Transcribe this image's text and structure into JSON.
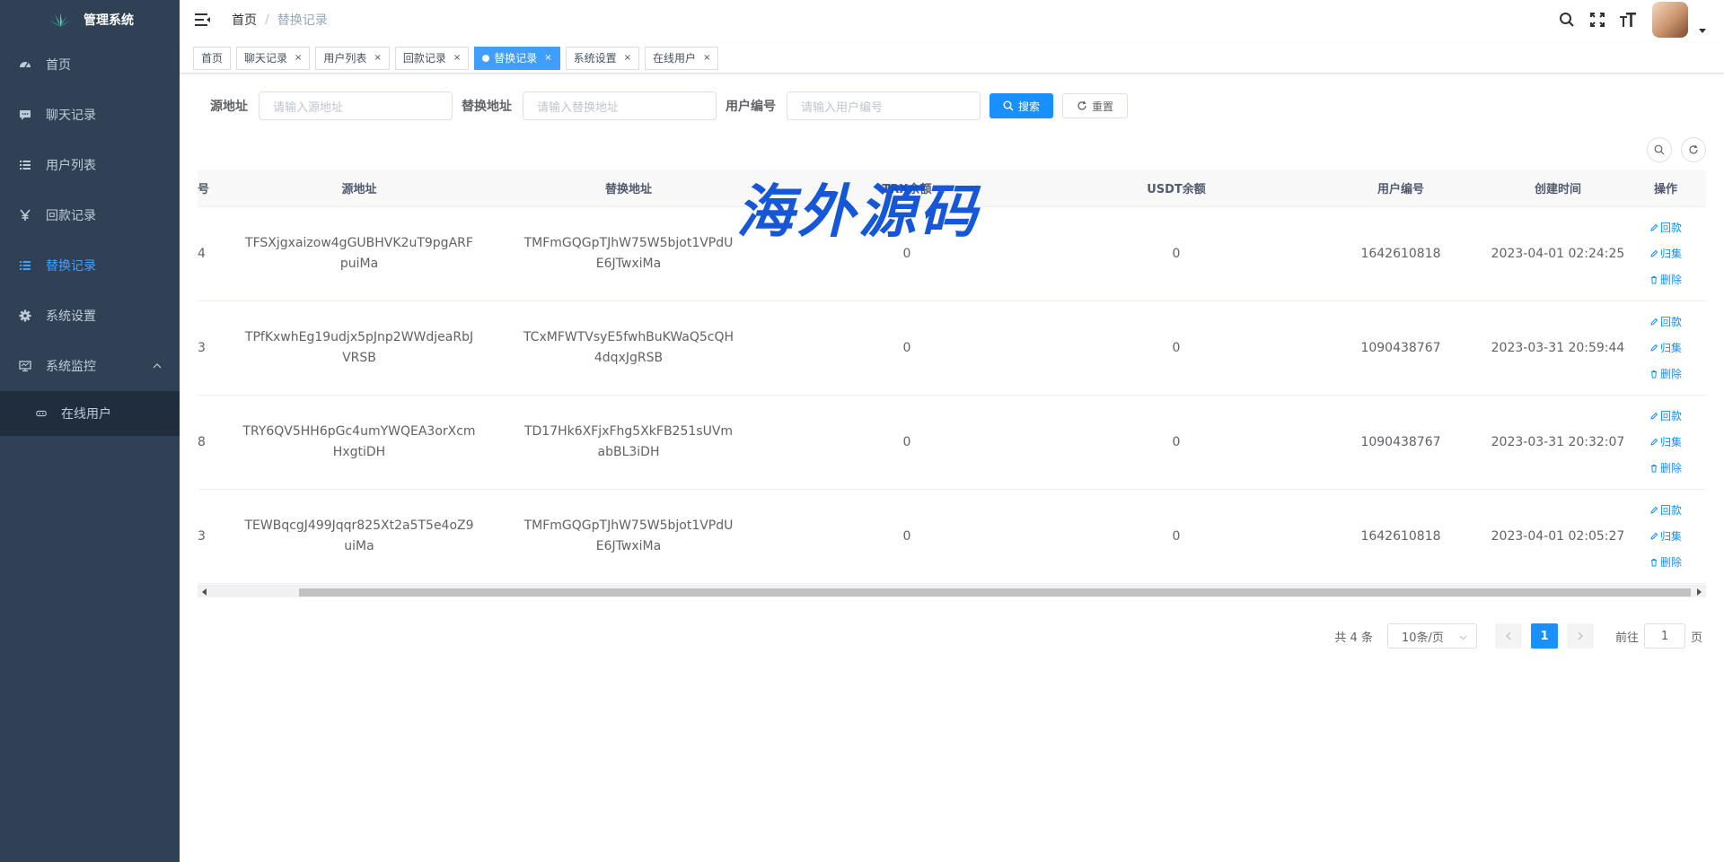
{
  "sidebar": {
    "title": "管理系统",
    "items": [
      {
        "label": "首页",
        "icon": "dashboard-icon"
      },
      {
        "label": "聊天记录",
        "icon": "message-icon"
      },
      {
        "label": "用户列表",
        "icon": "list-icon"
      },
      {
        "label": "回款记录",
        "icon": "yen-icon"
      },
      {
        "label": "替换记录",
        "icon": "list-icon",
        "active": true
      },
      {
        "label": "系统设置",
        "icon": "gear-icon"
      },
      {
        "label": "系统监控",
        "icon": "monitor-icon"
      }
    ],
    "subitems": [
      {
        "label": "在线用户",
        "icon": "online-icon"
      }
    ]
  },
  "navbar": {
    "breadcrumb": [
      "首页",
      "替换记录"
    ]
  },
  "tags": [
    {
      "label": "首页",
      "closable": false
    },
    {
      "label": "聊天记录",
      "closable": true
    },
    {
      "label": "用户列表",
      "closable": true
    },
    {
      "label": "回款记录",
      "closable": true
    },
    {
      "label": "替换记录",
      "closable": true,
      "active": true
    },
    {
      "label": "系统设置",
      "closable": true
    },
    {
      "label": "在线用户",
      "closable": true
    }
  ],
  "search": {
    "src_label": "源地址",
    "src_placeholder": "请输入源地址",
    "dst_label": "替换地址",
    "dst_placeholder": "请输入替换地址",
    "user_label": "用户编号",
    "user_placeholder": "请输入用户编号",
    "search_btn": "搜索",
    "reset_btn": "重置"
  },
  "table": {
    "columns": [
      "号",
      "源地址",
      "替换地址",
      "TRX余额",
      "USDT余额",
      "用户编号",
      "创建时间",
      "操作"
    ],
    "op_labels": [
      "回款",
      "归集",
      "删除"
    ],
    "rows": [
      {
        "id": "4",
        "src": "TFSXjgxaizow4gGUBHVK2uT9pgARFpuiMa",
        "dst": "TMFmGQGpTJhW75W5bjot1VPdUE6JTwxiMa",
        "trx": "0",
        "usdt": "0",
        "user": "1642610818",
        "time": "2023-04-01 02:24:25"
      },
      {
        "id": "3",
        "src": "TPfKxwhEg19udjx5pJnp2WWdjeaRbJVRSB",
        "dst": "TCxMFWTVsyE5fwhBuKWaQ5cQH4dqxJgRSB",
        "trx": "0",
        "usdt": "0",
        "user": "1090438767",
        "time": "2023-03-31 20:59:44"
      },
      {
        "id": "8",
        "src": "TRY6QV5HH6pGc4umYWQEA3orXcmHxgtiDH",
        "dst": "TD17Hk6XFjxFhg5XkFB251sUVmabBL3iDH",
        "trx": "0",
        "usdt": "0",
        "user": "1090438767",
        "time": "2023-03-31 20:32:07"
      },
      {
        "id": "3",
        "src": "TEWBqcgJ499Jqqr825Xt2a5T5e4oZ9uiMa",
        "dst": "TMFmGQGpTJhW75W5bjot1VPdUE6JTwxiMa",
        "trx": "0",
        "usdt": "0",
        "user": "1642610818",
        "time": "2023-04-01 02:05:27"
      }
    ]
  },
  "pagination": {
    "total": "共 4 条",
    "page_size": "10条/页",
    "current": "1",
    "goto_label": "前往",
    "goto_value": "1",
    "page_suffix": "页"
  },
  "watermark": "海外源码",
  "colors": {
    "primary": "#1890ff",
    "sidebar": "#304156",
    "active": "#409eff"
  }
}
